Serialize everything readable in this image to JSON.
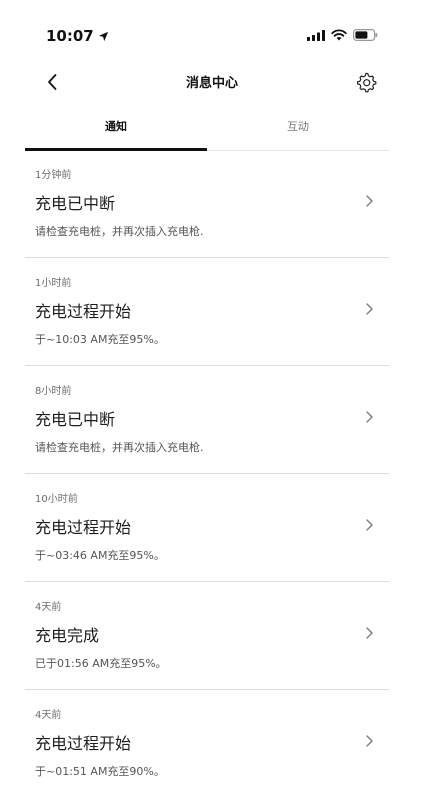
{
  "status_bar": {
    "time": "10:07"
  },
  "header": {
    "title": "消息中心",
    "back_icon": "chevron-left-icon",
    "settings_icon": "gear-icon"
  },
  "tabs": [
    {
      "label": "通知",
      "active": true
    },
    {
      "label": "互动",
      "active": false
    }
  ],
  "notifications": [
    {
      "time": "1分钟前",
      "title": "充电已中断",
      "desc": "请检查充电桩，并再次插入充电枪."
    },
    {
      "time": "1小时前",
      "title": "充电过程开始",
      "desc": "于~10:03 AM充至95%。"
    },
    {
      "time": "8小时前",
      "title": "充电已中断",
      "desc": "请检查充电桩，并再次插入充电枪."
    },
    {
      "time": "10小时前",
      "title": "充电过程开始",
      "desc": "于~03:46 AM充至95%。"
    },
    {
      "time": "4天前",
      "title": "充电完成",
      "desc": "已于01:56 AM充至95%。"
    },
    {
      "time": "4天前",
      "title": "充电过程开始",
      "desc": "于~01:51 AM充至90%。"
    }
  ]
}
